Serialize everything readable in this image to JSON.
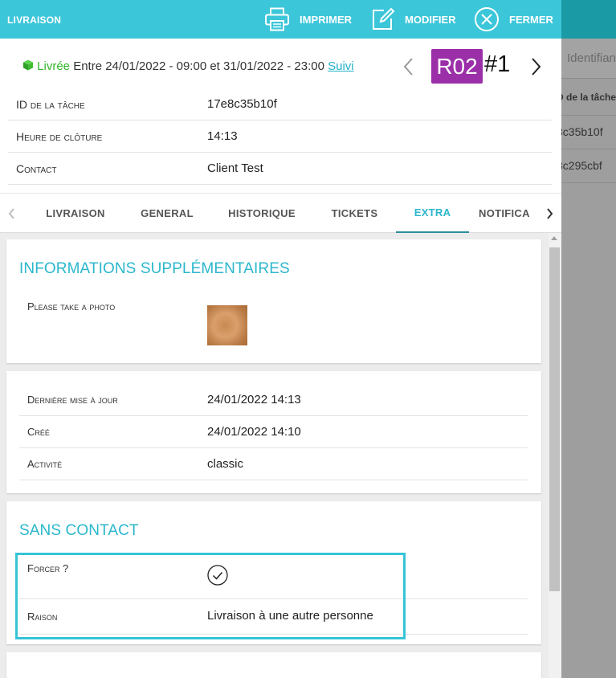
{
  "header": {
    "title": "LIVRAISON",
    "print_label": "IMPRIMER",
    "edit_label": "MODIFIER",
    "close_label": "FERMER"
  },
  "summary": {
    "status": "Livrée",
    "window_text": " Entre 24/01/2022 - 09:00 et 31/01/2022 - 23:00 ",
    "track_link": "Suivi",
    "route_badge": "R02",
    "stop_number": "#1"
  },
  "details": [
    {
      "label": "ID de la tâche",
      "value": "17e8c35b10f"
    },
    {
      "label": "Heure de clôture",
      "value": "14:13"
    },
    {
      "label": "Contact",
      "value": "Client Test"
    }
  ],
  "tabs": [
    "LIVRAISON",
    "GENERAL",
    "HISTORIQUE",
    "TICKETS",
    "EXTRA",
    "NOTIFICA"
  ],
  "active_tab": "EXTRA",
  "extra_info": {
    "title": "INFORMATIONS SUPPLÉMENTAIRES",
    "photo_label": "Please take a photo"
  },
  "meta": [
    {
      "label": "Dernière mise à jour",
      "value": "24/01/2022 14:13"
    },
    {
      "label": "Créé",
      "value": "24/01/2022 14:10"
    },
    {
      "label": "Activité",
      "value": "classic"
    }
  ],
  "contactless": {
    "title": "SANS CONTACT",
    "force_label": "Forcer ?",
    "force_checked": true,
    "reason_label": "Raison",
    "reason_value": "Livraison à une autre personne"
  },
  "background": {
    "search_placeholder": "Identifian",
    "column_header": "D de la tâche",
    "rows": [
      "8c35b10f",
      "8c295cbf"
    ]
  },
  "colors": {
    "header_bg": "#3cc6d9",
    "accent": "#2bb7cc",
    "status_green": "#33b52d",
    "badge_purple": "#9a2fa8"
  }
}
